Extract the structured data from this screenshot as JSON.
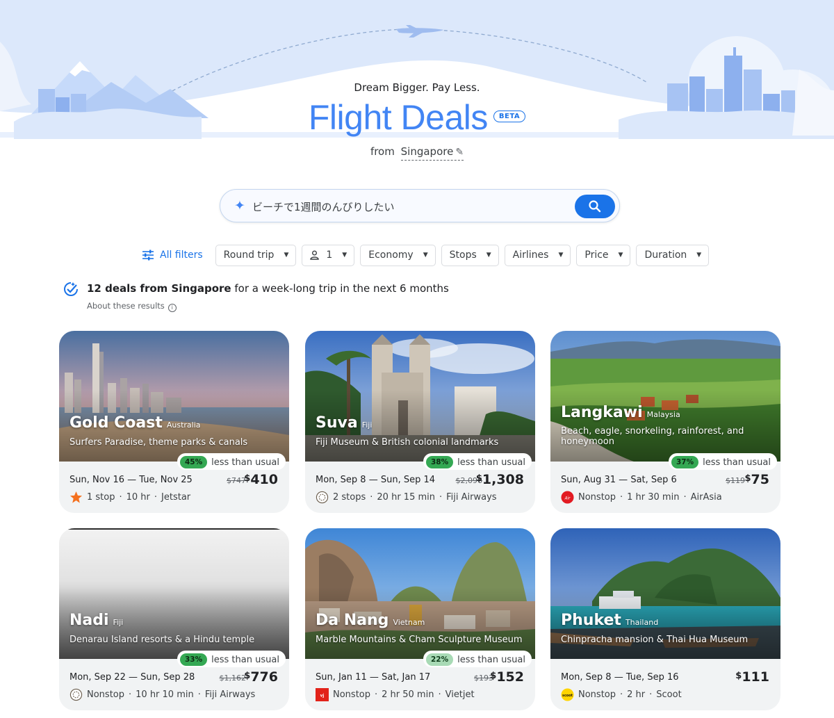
{
  "header": {
    "tagline": "Dream Bigger. Pay Less.",
    "title": "Flight Deals",
    "badge": "BETA",
    "from_label": "from",
    "from_city": "Singapore"
  },
  "search": {
    "value": "ビーチで1週間のんびりしたい"
  },
  "filters": {
    "all_filters": "All filters",
    "chips": [
      "Round trip",
      "1",
      "Economy",
      "Stops",
      "Airlines",
      "Price",
      "Duration"
    ]
  },
  "results": {
    "count_bold": "12 deals from Singapore",
    "count_rest": " for a week-long trip in the next 6 months",
    "about": "About these results"
  },
  "colors": {
    "accent": "#1a73e8",
    "title_blue": "#4285f4",
    "deal_green": "#34a853",
    "card_bg": "#f1f3f4"
  },
  "deals": [
    {
      "city": "Gold Coast",
      "country": "Australia",
      "description": "Surfers Paradise, theme parks & canals",
      "discount": "45%",
      "discount_label": "less than usual",
      "dates": "Sun, Nov 16 — Tue, Nov 25",
      "old_price": "$747",
      "price": "410",
      "currency": "$",
      "stops": "1 stop",
      "duration": "10 hr",
      "airline": "Jetstar",
      "airline_icon": "jetstar-star-icon"
    },
    {
      "city": "Suva",
      "country": "Fiji",
      "description": "Fiji Museum & British colonial landmarks",
      "discount": "38%",
      "discount_label": "less than usual",
      "dates": "Mon, Sep 8 — Sun, Sep 14",
      "old_price": "$2,096",
      "price": "1,308",
      "currency": "$",
      "stops": "2 stops",
      "duration": "20 hr 15 min",
      "airline": "Fiji Airways",
      "airline_icon": "fiji-airways-icon"
    },
    {
      "city": "Langkawi",
      "country": "Malaysia",
      "description": "Beach, eagle, snorkeling, rainforest, and honeymoon",
      "discount": "37%",
      "discount_label": "less than usual",
      "dates": "Sun, Aug 31 — Sat, Sep 6",
      "old_price": "$119",
      "price": "75",
      "currency": "$",
      "stops": "Nonstop",
      "duration": "1 hr 30 min",
      "airline": "AirAsia",
      "airline_icon": "airasia-icon"
    },
    {
      "city": "Nadi",
      "country": "Fiji",
      "description": "Denarau Island resorts & a Hindu temple",
      "discount": "33%",
      "discount_label": "less than usual",
      "dates": "Mon, Sep 22 — Sun, Sep 28",
      "old_price": "$1,162",
      "price": "776",
      "currency": "$",
      "stops": "Nonstop",
      "duration": "10 hr 10 min",
      "airline": "Fiji Airways",
      "airline_icon": "fiji-airways-icon"
    },
    {
      "city": "Da Nang",
      "country": "Vietnam",
      "description": "Marble Mountains & Cham Sculpture Museum",
      "discount": "22%",
      "discount_label": "less than usual",
      "dates": "Sun, Jan 11 — Sat, Jan 17",
      "old_price": "$193",
      "price": "152",
      "currency": "$",
      "stops": "Nonstop",
      "duration": "2 hr 50 min",
      "airline": "Vietjet",
      "airline_icon": "vietjet-icon"
    },
    {
      "city": "Phuket",
      "country": "Thailand",
      "description": "Chinpracha mansion & Thai Hua Museum",
      "discount": "",
      "discount_label": "",
      "dates": "Mon, Sep 8 — Tue, Sep 16",
      "old_price": "",
      "price": "111",
      "currency": "$",
      "stops": "Nonstop",
      "duration": "2 hr",
      "airline": "Scoot",
      "airline_icon": "scoot-icon"
    }
  ]
}
